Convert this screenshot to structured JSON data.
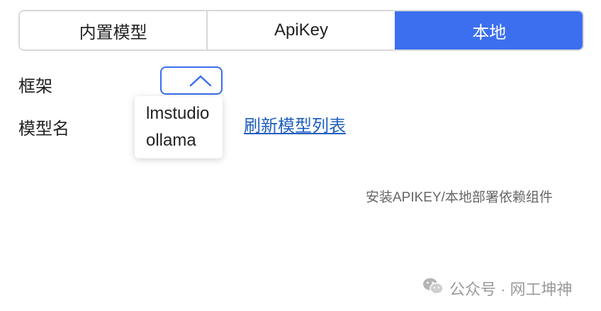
{
  "tabs": [
    {
      "label": "内置模型",
      "active": false
    },
    {
      "label": "ApiKey",
      "active": false
    },
    {
      "label": "本地",
      "active": true
    }
  ],
  "form": {
    "framework_label": "框架",
    "model_name_label": "模型名",
    "framework_select": {
      "expanded": true,
      "icon": "chevron-up-icon"
    },
    "framework_options": [
      "lmstudio",
      "ollama"
    ],
    "refresh_link": "刷新模型列表"
  },
  "install_link": "安装APIKEY/本地部署依赖组件",
  "watermark": {
    "icon": "wechat-icon",
    "text": "公众号 · 网工坤神"
  },
  "colors": {
    "accent": "#3b6ff0",
    "link": "#1f5fbf"
  }
}
